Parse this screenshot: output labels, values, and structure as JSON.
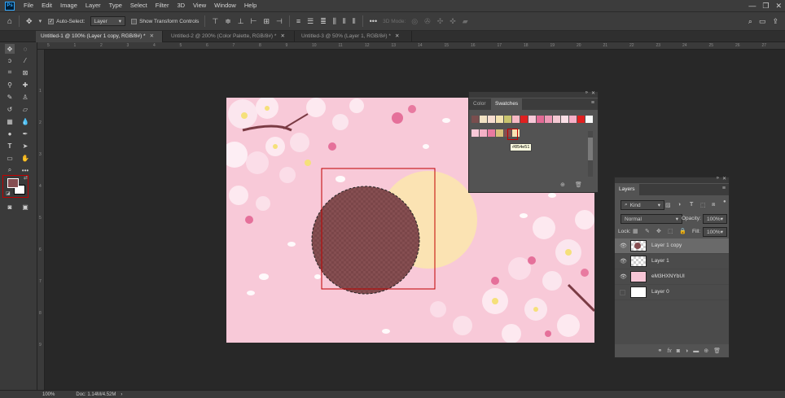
{
  "app": {
    "logo": "Ps"
  },
  "menu": [
    "File",
    "Edit",
    "Image",
    "Layer",
    "Type",
    "Select",
    "Filter",
    "3D",
    "View",
    "Window",
    "Help"
  ],
  "options": {
    "auto_select_label": "Auto-Select:",
    "auto_select_value": "Layer",
    "transform_label": "Show Transform Controls",
    "mode_3d": "3D Mode:"
  },
  "tabs": [
    {
      "label": "Untitled-1 @ 100% (Layer 1 copy, RGB/8#) *",
      "active": true
    },
    {
      "label": "Untitled-2 @ 200% (Color Palette, RGB/8#) *",
      "active": false
    },
    {
      "label": "Untitled-3 @ 50% (Layer 1, RGB/8#) *",
      "active": false
    }
  ],
  "ruler": {
    "top": [
      "5",
      "1",
      "2",
      "3",
      "4",
      "5",
      "6",
      "7",
      "8",
      "9",
      "10",
      "11",
      "12",
      "13",
      "14",
      "15",
      "16",
      "17",
      "18",
      "19",
      "20",
      "21",
      "22",
      "23",
      "24",
      "25",
      "26",
      "27"
    ],
    "left": [
      "1",
      "2",
      "3",
      "4",
      "5",
      "6",
      "7",
      "8",
      "9"
    ]
  },
  "status": {
    "zoom": "100%",
    "doc": "Doc: 1.14M/4.52M"
  },
  "swatches_panel": {
    "tabs": [
      "Color",
      "Swatches"
    ],
    "active_tab": "Swatches",
    "row1": [
      "#7a4e4e",
      "#f2e2c4",
      "#f7ddd0",
      "#f4e3b0",
      "#c9c46e",
      "#f6b8c4",
      "#e02020",
      "#f7c8d8",
      "#e26a95",
      "#ee98b6",
      "#f4c9d3",
      "#fadfe6",
      "#f6b0c8",
      "#e02020",
      "#fafafa"
    ],
    "row2": [
      "#f9c9d8",
      "#f4b1c6",
      "#e87aa0",
      "#d8c07a",
      "#854e51",
      "#fbe3b3"
    ],
    "tooltip": "#854e51"
  },
  "layers_panel": {
    "title": "Layers",
    "kind_label": "Kind",
    "blend_mode": "Normal",
    "opacity_label": "Opacity:",
    "opacity_value": "100%",
    "lock_label": "Lock:",
    "fill_label": "Fill:",
    "fill_value": "100%",
    "layers": [
      {
        "name": "Layer 1 copy",
        "visible": true,
        "selected": true
      },
      {
        "name": "Layer 1",
        "visible": true,
        "selected": false
      },
      {
        "name": "eM3HXNYbUI",
        "visible": true,
        "selected": false
      },
      {
        "name": "Layer 0",
        "visible": false,
        "selected": false
      }
    ]
  },
  "colors": {
    "foreground": "#854e51",
    "background": "#ffffff",
    "selection": "#c00000"
  }
}
